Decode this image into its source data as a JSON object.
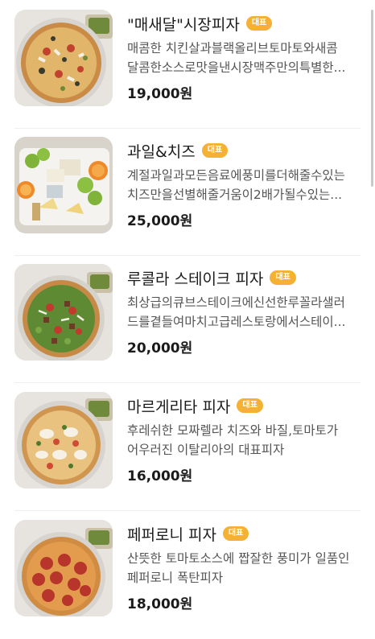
{
  "menu": {
    "items": [
      {
        "name": "\"매새달\"시장피자",
        "badge": "대표",
        "desc_line1": "매콤한 치킨살과블랙올리브토마토와새콤",
        "desc_line2": "달콤한소스로맛을낸시장맥주만의특별한...",
        "price": "19,000원",
        "image": "chicken-olive-pizza-photo"
      },
      {
        "name": "과일&치즈",
        "badge": "대표",
        "desc_line1": "계절과일과모든음료에풍미를더해줄수있는",
        "desc_line2": "치즈만을선별해줄거움이2배가될수있는...",
        "price": "25,000원",
        "image": "fruit-cheese-platter-photo"
      },
      {
        "name": "루콜라 스테이크 피자",
        "badge": "대표",
        "desc_line1": "최상급의큐브스테이크에신선한루꼴라샐러",
        "desc_line2": "드를곁들여마치고급레스토랑에서스테이...",
        "price": "20,000원",
        "image": "arugula-steak-pizza-photo"
      },
      {
        "name": "마르게리타 피자",
        "badge": "대표",
        "desc_line1": "후레쉬한 모짜렐라 치즈와 바질,토마토가",
        "desc_line2": "어우러진 이탈리아의 대표피자",
        "price": "16,000원",
        "image": "margherita-pizza-photo"
      },
      {
        "name": "페퍼로니 피자",
        "badge": "대표",
        "desc_line1": "산뜻한 토마토소스에 짭잘한 풍미가 일품인",
        "desc_line2": "페퍼로니 폭탄피자",
        "price": "18,000원",
        "image": "pepperoni-pizza-photo"
      }
    ]
  }
}
